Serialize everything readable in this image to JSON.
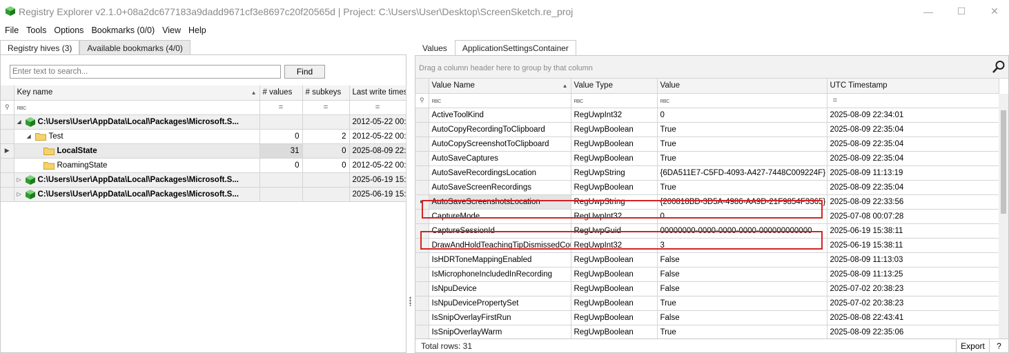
{
  "window": {
    "title": "Registry Explorer v2.1.0+08a2dc677183a9dadd9671cf3e8697c20f20565d | Project: C:\\Users\\User\\Desktop\\ScreenSketch.re_proj"
  },
  "menu": [
    "File",
    "Tools",
    "Options",
    "Bookmarks (0/0)",
    "View",
    "Help"
  ],
  "left": {
    "tabs": [
      "Registry hives (3)",
      "Available bookmarks (4/0)"
    ],
    "search_placeholder": "Enter text to search...",
    "find_label": "Find",
    "columns": [
      "Key name",
      "# values",
      "# subkeys",
      "Last write timest"
    ],
    "filter_abc": "RBC",
    "filter_eq": "=",
    "rows": [
      {
        "key": "C:\\Users\\User\\AppData\\Local\\Packages\\Microsoft.S...",
        "values": "",
        "subkeys": "",
        "last_write": "2012-05-22 00:0"
      },
      {
        "key": "Test",
        "values": "0",
        "subkeys": "2",
        "last_write": "2012-05-22 00:0"
      },
      {
        "key": "LocalState",
        "values": "31",
        "subkeys": "0",
        "last_write": "2025-08-09 22:"
      },
      {
        "key": "RoamingState",
        "values": "0",
        "subkeys": "0",
        "last_write": "2012-05-22 00:0"
      },
      {
        "key": "C:\\Users\\User\\AppData\\Local\\Packages\\Microsoft.S...",
        "values": "",
        "subkeys": "",
        "last_write": "2025-06-19 15:"
      },
      {
        "key": "C:\\Users\\User\\AppData\\Local\\Packages\\Microsoft.S...",
        "values": "",
        "subkeys": "",
        "last_write": "2025-06-19 15:1"
      }
    ]
  },
  "right": {
    "tabs": [
      "Values",
      "ApplicationSettingsContainer"
    ],
    "group_hint": "Drag a column header here to group by that column",
    "columns": [
      "Value Name",
      "Value Type",
      "Value",
      "UTC Timestamp"
    ],
    "filter_abc": "RBC",
    "filter_eq": "=",
    "rows": [
      {
        "name": "ActiveToolKind",
        "type": "RegUwpInt32",
        "value": "0",
        "ts": "2025-08-09 22:34:01"
      },
      {
        "name": "AutoCopyRecordingToClipboard",
        "type": "RegUwpBoolean",
        "value": "True",
        "ts": "2025-08-09 22:35:04"
      },
      {
        "name": "AutoCopyScreenshotToClipboard",
        "type": "RegUwpBoolean",
        "value": "True",
        "ts": "2025-08-09 22:35:04"
      },
      {
        "name": "AutoSaveCaptures",
        "type": "RegUwpBoolean",
        "value": "True",
        "ts": "2025-08-09 22:35:04"
      },
      {
        "name": "AutoSaveRecordingsLocation",
        "type": "RegUwpString",
        "value": "{6DA511E7-C5FD-4093-A427-7448C009224F}",
        "ts": "2025-08-09 11:13:19"
      },
      {
        "name": "AutoSaveScreenRecordings",
        "type": "RegUwpBoolean",
        "value": "True",
        "ts": "2025-08-09 22:35:04"
      },
      {
        "name": "AutoSaveScreenshotsLocation",
        "type": "RegUwpString",
        "value": "{200818BD-3D5A-4986-AA9D-21F9854F3365}",
        "ts": "2025-08-09 22:33:56"
      },
      {
        "name": "CaptureMode",
        "type": "RegUwpInt32",
        "value": "0",
        "ts": "2025-07-08 00:07:28"
      },
      {
        "name": "CaptureSessionId",
        "type": "RegUwpGuid",
        "value": "00000000-0000-0000-0000-000000000000",
        "ts": "2025-06-19 15:38:11"
      },
      {
        "name": "DrawAndHoldTeachingTipDismissedCount",
        "type": "RegUwpInt32",
        "value": "3",
        "ts": "2025-06-19 15:38:11"
      },
      {
        "name": "IsHDRToneMappingEnabled",
        "type": "RegUwpBoolean",
        "value": "False",
        "ts": "2025-08-09 11:13:03"
      },
      {
        "name": "IsMicrophoneIncludedInRecording",
        "type": "RegUwpBoolean",
        "value": "False",
        "ts": "2025-08-09 11:13:25"
      },
      {
        "name": "IsNpuDevice",
        "type": "RegUwpBoolean",
        "value": "False",
        "ts": "2025-07-02 20:38:23"
      },
      {
        "name": "IsNpuDevicePropertySet",
        "type": "RegUwpBoolean",
        "value": "True",
        "ts": "2025-07-02 20:38:23"
      },
      {
        "name": "IsSnipOverlayFirstRun",
        "type": "RegUwpBoolean",
        "value": "False",
        "ts": "2025-08-08 22:43:41"
      },
      {
        "name": "IsSnipOverlayWarm",
        "type": "RegUwpBoolean",
        "value": "True",
        "ts": "2025-08-09 22:35:06"
      }
    ],
    "total_rows": "Total rows: 31",
    "export_label": "Export",
    "help_label": "?"
  },
  "colors": {
    "highlight": "#d42222",
    "folder": "#f5d36b",
    "hive": "#3fa33f"
  }
}
